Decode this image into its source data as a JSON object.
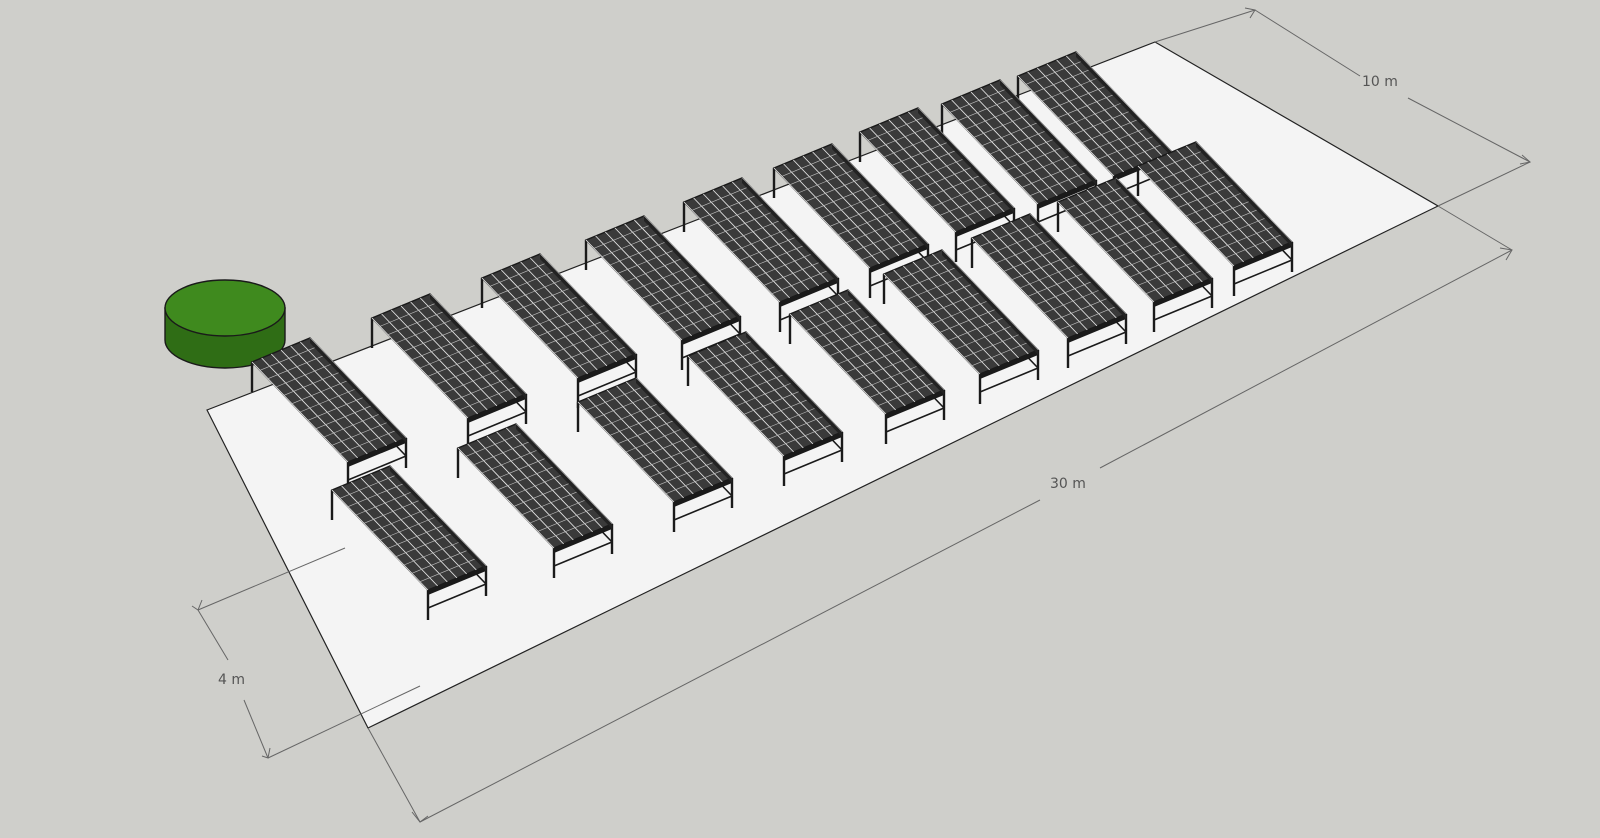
{
  "scene": {
    "background_color": "#cfcfcb",
    "floor_color": "#f4f4f4",
    "table_color": "#1a1a1a",
    "tank_color": "#3f8a1e",
    "rows": {
      "back_row_count": 9,
      "front_row_count": 9
    }
  },
  "dimensions": {
    "width_label": "10 m",
    "length_label": "30 m",
    "spacing_label": "4 m"
  },
  "tank": {
    "icon": "water-tank-cylinder"
  }
}
